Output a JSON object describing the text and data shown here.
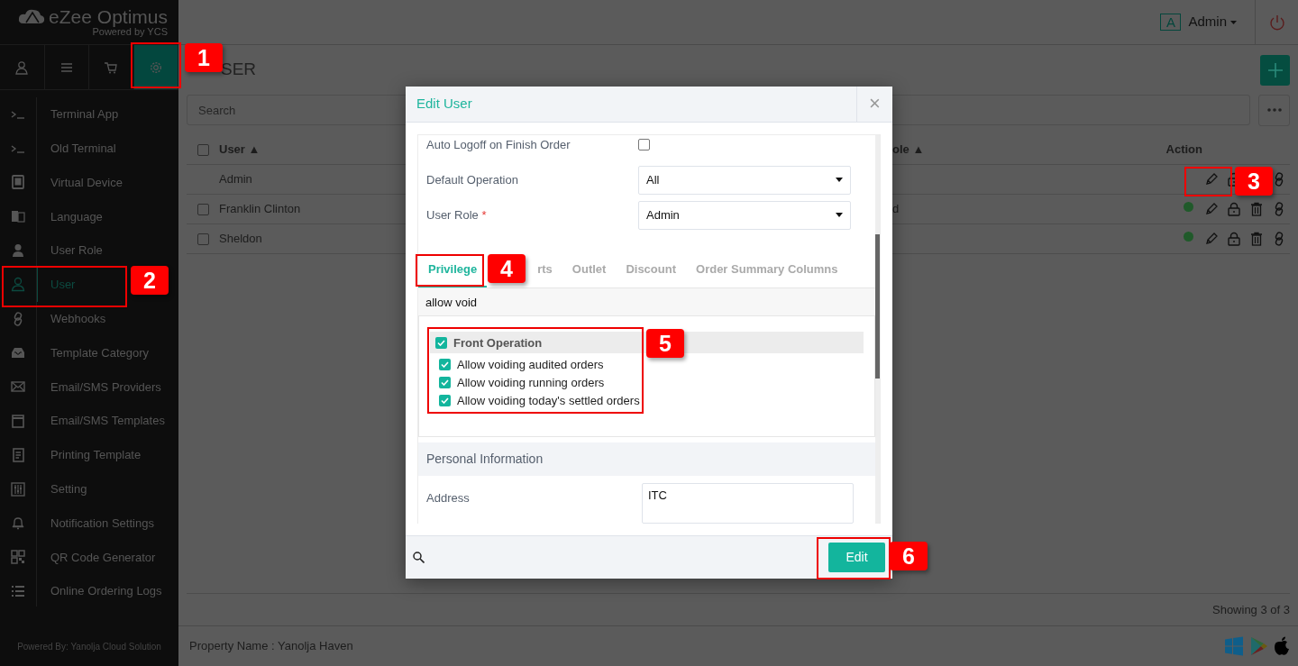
{
  "brand": {
    "name": "eZee Optimus",
    "tagline": "Powered by YCS"
  },
  "nav_tabs": [
    {
      "selected": false
    },
    {
      "selected": false
    },
    {
      "selected": false
    },
    {
      "selected": true
    }
  ],
  "sidebar": {
    "items": [
      {
        "label": "Terminal App",
        "selected": false
      },
      {
        "label": "Old Terminal",
        "selected": false
      },
      {
        "label": "Virtual Device",
        "selected": false
      },
      {
        "label": "Language",
        "selected": false
      },
      {
        "label": "User Role",
        "selected": false
      },
      {
        "label": "User",
        "selected": true
      },
      {
        "label": "Webhooks",
        "selected": false
      },
      {
        "label": "Template Category",
        "selected": false
      },
      {
        "label": "Email/SMS Providers",
        "selected": false
      },
      {
        "label": "Email/SMS Templates",
        "selected": false
      },
      {
        "label": "Printing Template",
        "selected": false
      },
      {
        "label": "Setting",
        "selected": false
      },
      {
        "label": "Notification Settings",
        "selected": false
      },
      {
        "label": "QR Code Generator",
        "selected": false
      },
      {
        "label": "Online Ordering Logs",
        "selected": false
      }
    ],
    "footer": "Powered By: Yanolja Cloud Solution"
  },
  "topbar": {
    "avatar_letter": "A",
    "user": "Admin"
  },
  "page": {
    "title": "SER",
    "search": {
      "placeholder": "Search"
    }
  },
  "table": {
    "columns": [
      "User ▲",
      "ole ▲",
      "Action"
    ],
    "select_all_checked": false,
    "rows": [
      {
        "kind": "owner",
        "user": "Admin"
      },
      {
        "kind": "user",
        "user": "Franklin Clinton",
        "role": "d",
        "checked": false
      },
      {
        "kind": "user",
        "user": "Sheldon",
        "checked": false
      }
    ],
    "footer": "Showing 3 of 3"
  },
  "status_bar": {
    "property": "Property Name : Yanolja Haven"
  },
  "modal": {
    "title": "Edit User",
    "close": "×",
    "fields": [
      {
        "kind": "checkbox",
        "label": "Auto Logoff on Finish Order",
        "checked": false
      },
      {
        "kind": "select",
        "label": "Default Operation",
        "value": "All"
      },
      {
        "kind": "select",
        "label": "User Role",
        "value": "Admin",
        "required_mark": "*"
      }
    ],
    "tabs": [
      {
        "label": "Privilege",
        "selected": true
      },
      {
        "label": "rts",
        "selected": false
      },
      {
        "label": "Outlet",
        "selected": false
      },
      {
        "label": "Discount",
        "selected": false
      },
      {
        "label": "Order Summary Columns",
        "selected": false
      }
    ],
    "filter": {
      "value": "allow void"
    },
    "tree": [
      {
        "label": "Front Operation",
        "checked": true,
        "children": [
          {
            "label": "Allow voiding audited orders",
            "checked": true
          },
          {
            "label": "Allow voiding running orders",
            "checked": true
          },
          {
            "label": "Allow voiding today's settled orders",
            "checked": true
          }
        ]
      }
    ],
    "section": "Personal Information",
    "address": {
      "label": "Address",
      "value": "ITC"
    },
    "submit": "Edit"
  },
  "callouts": [
    {
      "label": "1"
    },
    {
      "label": "2"
    },
    {
      "label": "3"
    },
    {
      "label": "4"
    },
    {
      "label": "5"
    },
    {
      "label": "6"
    }
  ]
}
